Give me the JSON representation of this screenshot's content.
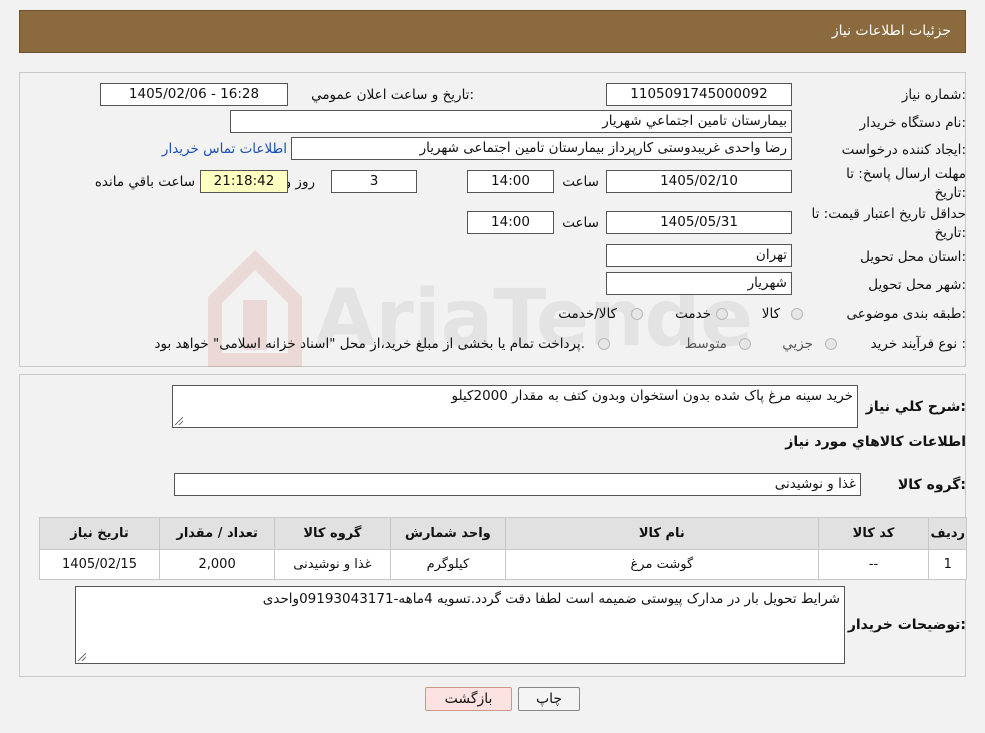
{
  "header": {
    "title": "جزئیات اطلاعات نیاز"
  },
  "fields": {
    "need_number_label": "شماره نیاز:",
    "need_number": "1105091745000092",
    "announce_label": "تاريخ و ساعت اعلان عمومي:",
    "announce_value": "1405/02/06 - 16:28",
    "buyer_org_label": "نام دستگاه خريدار:",
    "buyer_org": "بيمارستان تامين اجتماعي شهريار",
    "creator_label": "ايجاد کننده درخواست:",
    "creator": "رضا واحدی غریبدوستی کارپرداز بیمارستان تامین اجتماعی شهریار",
    "contact_link": "اطلاعات تماس خريدار",
    "deadline_label_1": "مهلت ارسال پاسخ: تا",
    "deadline_label_2": "تاريخ:",
    "deadline_date": "1405/02/10",
    "time_label": "ساعت",
    "deadline_time": "14:00",
    "days_value": "3",
    "days_label": "روز و",
    "remaining_time": "21:18:42",
    "remaining_label": "ساعت باقي مانده",
    "price_validity_label_1": "حداقل تاريخ اعتبار قيمت: تا",
    "price_validity_label_2": "تاريخ:",
    "price_validity_date": "1405/05/31",
    "price_validity_time": "14:00",
    "province_label": "استان محل تحويل:",
    "province": "تهران",
    "city_label": "شهر محل تحويل:",
    "city": "شهريار",
    "category_label": "طبقه بندی موضوعی:",
    "category_options": [
      "کالا",
      "خدمت",
      "کالا/خدمت"
    ],
    "process_label": "نوع فرآيند خريد :",
    "process_options": [
      "جزيي",
      "متوسط"
    ],
    "process_note": "پرداخت تمام يا بخشی از مبلغ خريد،از محل \"اسناد خزانه اسلامی\" خواهد بود."
  },
  "description": {
    "label": "شرح کلي نياز:",
    "value": "خريد سينه مرغ پاک شده بدون استخوان وبدون کتف به مقدار 2000کيلو"
  },
  "goods_section_title": "اطلاعات کالاهاي مورد نياز",
  "goods_group": {
    "label": "گروه کالا:",
    "value": "غذا و نوشيدنی"
  },
  "table": {
    "headers": [
      "رديف",
      "کد کالا",
      "نام کالا",
      "واحد شمارش",
      "گروه کالا",
      "تعداد / مقدار",
      "تاريخ نياز"
    ],
    "rows": [
      [
        "1",
        "--",
        "گوشت مرغ",
        "کيلوگرم",
        "غذا و نوشيدنی",
        "2,000",
        "1405/02/15"
      ]
    ]
  },
  "buyer_notes": {
    "label": "توضيحات خريدار:",
    "value": "شرايط تحويل بار در مدارک پيوستی ضميمه است لطفا دقت گردد.تسويه 4ماهه-09193043171واحدی"
  },
  "buttons": {
    "print": "چاپ",
    "back": "بازگشت"
  },
  "watermark": {
    "text": "AriaTender.neT"
  }
}
